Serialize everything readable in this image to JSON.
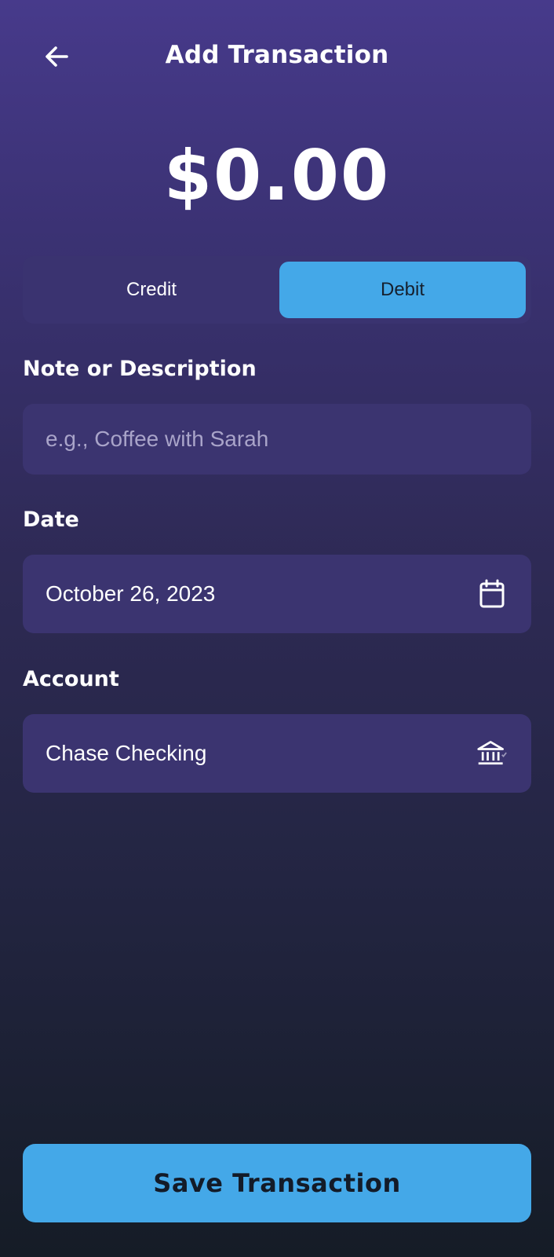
{
  "header": {
    "title": "Add Transaction",
    "back_icon": "arrow-left-icon"
  },
  "amount": "$0.00",
  "type_toggle": {
    "options": [
      "Credit",
      "Debit"
    ],
    "selected": "Debit"
  },
  "note": {
    "label": "Note or Description",
    "value": "",
    "placeholder": "e.g., Coffee with Sarah"
  },
  "date": {
    "label": "Date",
    "value": "October 26, 2023",
    "icon": "calendar-icon"
  },
  "account": {
    "label": "Account",
    "value": "Chase Checking",
    "icon": "bank-icon"
  },
  "save_button": "Save Transaction",
  "colors": {
    "accent": "#44A8E8",
    "field_bg": "#3B3470",
    "bg_top": "#473A8B",
    "bg_bottom": "#151C26"
  }
}
